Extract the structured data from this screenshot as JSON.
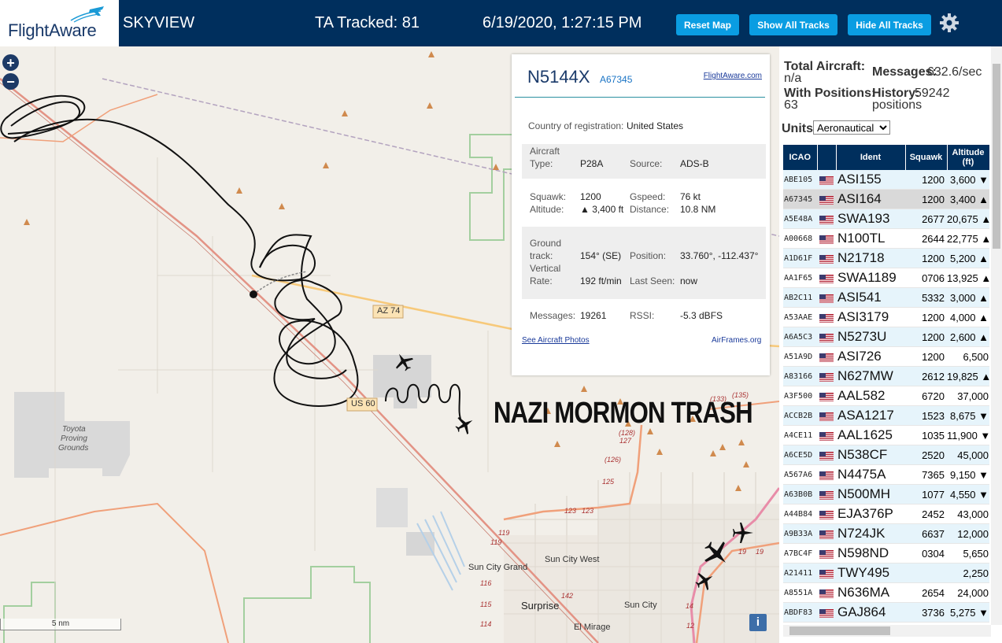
{
  "header": {
    "logo_text": "FlightAware",
    "app_name": "SKYVIEW",
    "tracked": "TA Tracked: 81",
    "datetime": "6/19/2020, 1:27:15 PM",
    "reset_label": "Reset Map",
    "show_label": "Show All Tracks",
    "hide_label": "Hide All Tracks"
  },
  "map": {
    "zoom_in": "+",
    "zoom_out": "−",
    "overlay_text": "NAZI MORMON TRASH",
    "scale": "5 nm",
    "info": "i",
    "labels": {
      "az74": "AZ 74",
      "us60": "US 60",
      "toyota1": "Toyota",
      "toyota2": "Proving",
      "toyota3": "Grounds",
      "sun_city_grand": "Sun City Grand",
      "sun_city_west": "Sun City West",
      "surprise": "Surprise",
      "sun_city": "Sun City",
      "el_mirage": "El Mirage",
      "r119a": "119",
      "r119b": "119",
      "r123a": "123",
      "r123b": "123",
      "r125": "125",
      "r126": "(126)",
      "r127": "127",
      "r128": "(128)",
      "r133": "(133)",
      "r135": "(135)",
      "r142": "142",
      "r115": "115",
      "r116": "116",
      "r114": "114",
      "r14": "14",
      "r12": "12",
      "r19a": "19",
      "r19b": "19"
    }
  },
  "selected": {
    "registration": "N5144X",
    "hex": "A67345",
    "fa_link": "FlightAware.com",
    "country_label": "Country of registration:",
    "country": "United States",
    "type_label1": "Aircraft",
    "type_label2": "Type:",
    "type": "P28A",
    "source_label": "Source:",
    "source": "ADS-B",
    "squawk_label": "Squawk:",
    "squawk": "1200",
    "gspeed_label": "Gspeed:",
    "gspeed": "76 kt",
    "altitude_label": "Altitude:",
    "altitude": "▲ 3,400 ft",
    "distance_label": "Distance:",
    "distance": "10.8 NM",
    "track_label1": "Ground",
    "track_label2": "track:",
    "track": "154° (SE)",
    "position_label": "Position:",
    "position": "33.760°, -112.437°",
    "vrate_label1": "Vertical",
    "vrate_label2": "Rate:",
    "vrate": "192 ft/min",
    "lastseen_label": "Last Seen:",
    "lastseen": "now",
    "messages_label": "Messages:",
    "messages": "19261",
    "rssi_label": "RSSI:",
    "rssi": "-5.3 dBFS",
    "photos_link": "See Aircraft Photos",
    "airframes_link": "AirFrames.org"
  },
  "sidebar": {
    "total_label": "Total Aircraft:",
    "total": "n/a",
    "msgs_label": "Messages:",
    "msgs": "632.6/sec",
    "withpos_label": "With Positions:",
    "withpos": "63",
    "history_label": "History:",
    "history1": "59242",
    "history2": "positions",
    "units_label": "Units:",
    "units": "Aeronautical",
    "columns": {
      "icao": "ICAO",
      "ident": "Ident",
      "squawk": "Squawk",
      "alt1": "Altitude",
      "alt2": "(ft)"
    }
  },
  "aircraft": [
    {
      "icao": "ABE105",
      "ident": "ASI155",
      "squawk": "1200",
      "alt": "3,600 ▼"
    },
    {
      "icao": "A67345",
      "ident": "ASI164",
      "squawk": "1200",
      "alt": "3,400 ▲"
    },
    {
      "icao": "A5E48A",
      "ident": "SWA193",
      "squawk": "2677",
      "alt": "20,675 ▲"
    },
    {
      "icao": "A00668",
      "ident": "N100TL",
      "squawk": "2644",
      "alt": "22,775 ▲"
    },
    {
      "icao": "A1D61F",
      "ident": "N21718",
      "squawk": "1200",
      "alt": "5,200 ▲"
    },
    {
      "icao": "AA1F65",
      "ident": "SWA1189",
      "squawk": "0706",
      "alt": "13,925 ▲"
    },
    {
      "icao": "AB2C11",
      "ident": "ASI541",
      "squawk": "5332",
      "alt": "3,000 ▲"
    },
    {
      "icao": "A53AAE",
      "ident": "ASI3179",
      "squawk": "1200",
      "alt": "4,000 ▲"
    },
    {
      "icao": "A6A5C3",
      "ident": "N5273U",
      "squawk": "1200",
      "alt": "2,600 ▲"
    },
    {
      "icao": "A51A9D",
      "ident": "ASI726",
      "squawk": "1200",
      "alt": "6,500"
    },
    {
      "icao": "A83166",
      "ident": "N627MW",
      "squawk": "2612",
      "alt": "19,825 ▲"
    },
    {
      "icao": "A3F500",
      "ident": "AAL582",
      "squawk": "6720",
      "alt": "37,000"
    },
    {
      "icao": "ACCB2B",
      "ident": "ASA1217",
      "squawk": "1523",
      "alt": "8,675 ▼"
    },
    {
      "icao": "A4CE11",
      "ident": "AAL1625",
      "squawk": "1035",
      "alt": "11,900 ▼"
    },
    {
      "icao": "A6CE5D",
      "ident": "N538CF",
      "squawk": "2520",
      "alt": "45,000"
    },
    {
      "icao": "A567A6",
      "ident": "N4475A",
      "squawk": "7365",
      "alt": "9,150 ▼"
    },
    {
      "icao": "A63B0B",
      "ident": "N500MH",
      "squawk": "1077",
      "alt": "4,550 ▼"
    },
    {
      "icao": "A44B84",
      "ident": "EJA376P",
      "squawk": "2452",
      "alt": "43,000"
    },
    {
      "icao": "A9B33A",
      "ident": "N724JK",
      "squawk": "6637",
      "alt": "12,000"
    },
    {
      "icao": "A7BC4F",
      "ident": "N598ND",
      "squawk": "0304",
      "alt": "5,650"
    },
    {
      "icao": "A21411",
      "ident": "TWY495",
      "squawk": "",
      "alt": "2,250"
    },
    {
      "icao": "A8551A",
      "ident": "N636MA",
      "squawk": "2654",
      "alt": "24,000"
    },
    {
      "icao": "ABDF83",
      "ident": "GAJ864",
      "squawk": "3736",
      "alt": "5,275 ▼"
    }
  ],
  "selected_index": 1,
  "colors": {
    "header": "#002f5d",
    "button": "#0a9de2",
    "row_even": "#e6f4fb",
    "row_selected": "#d9d9d9"
  }
}
